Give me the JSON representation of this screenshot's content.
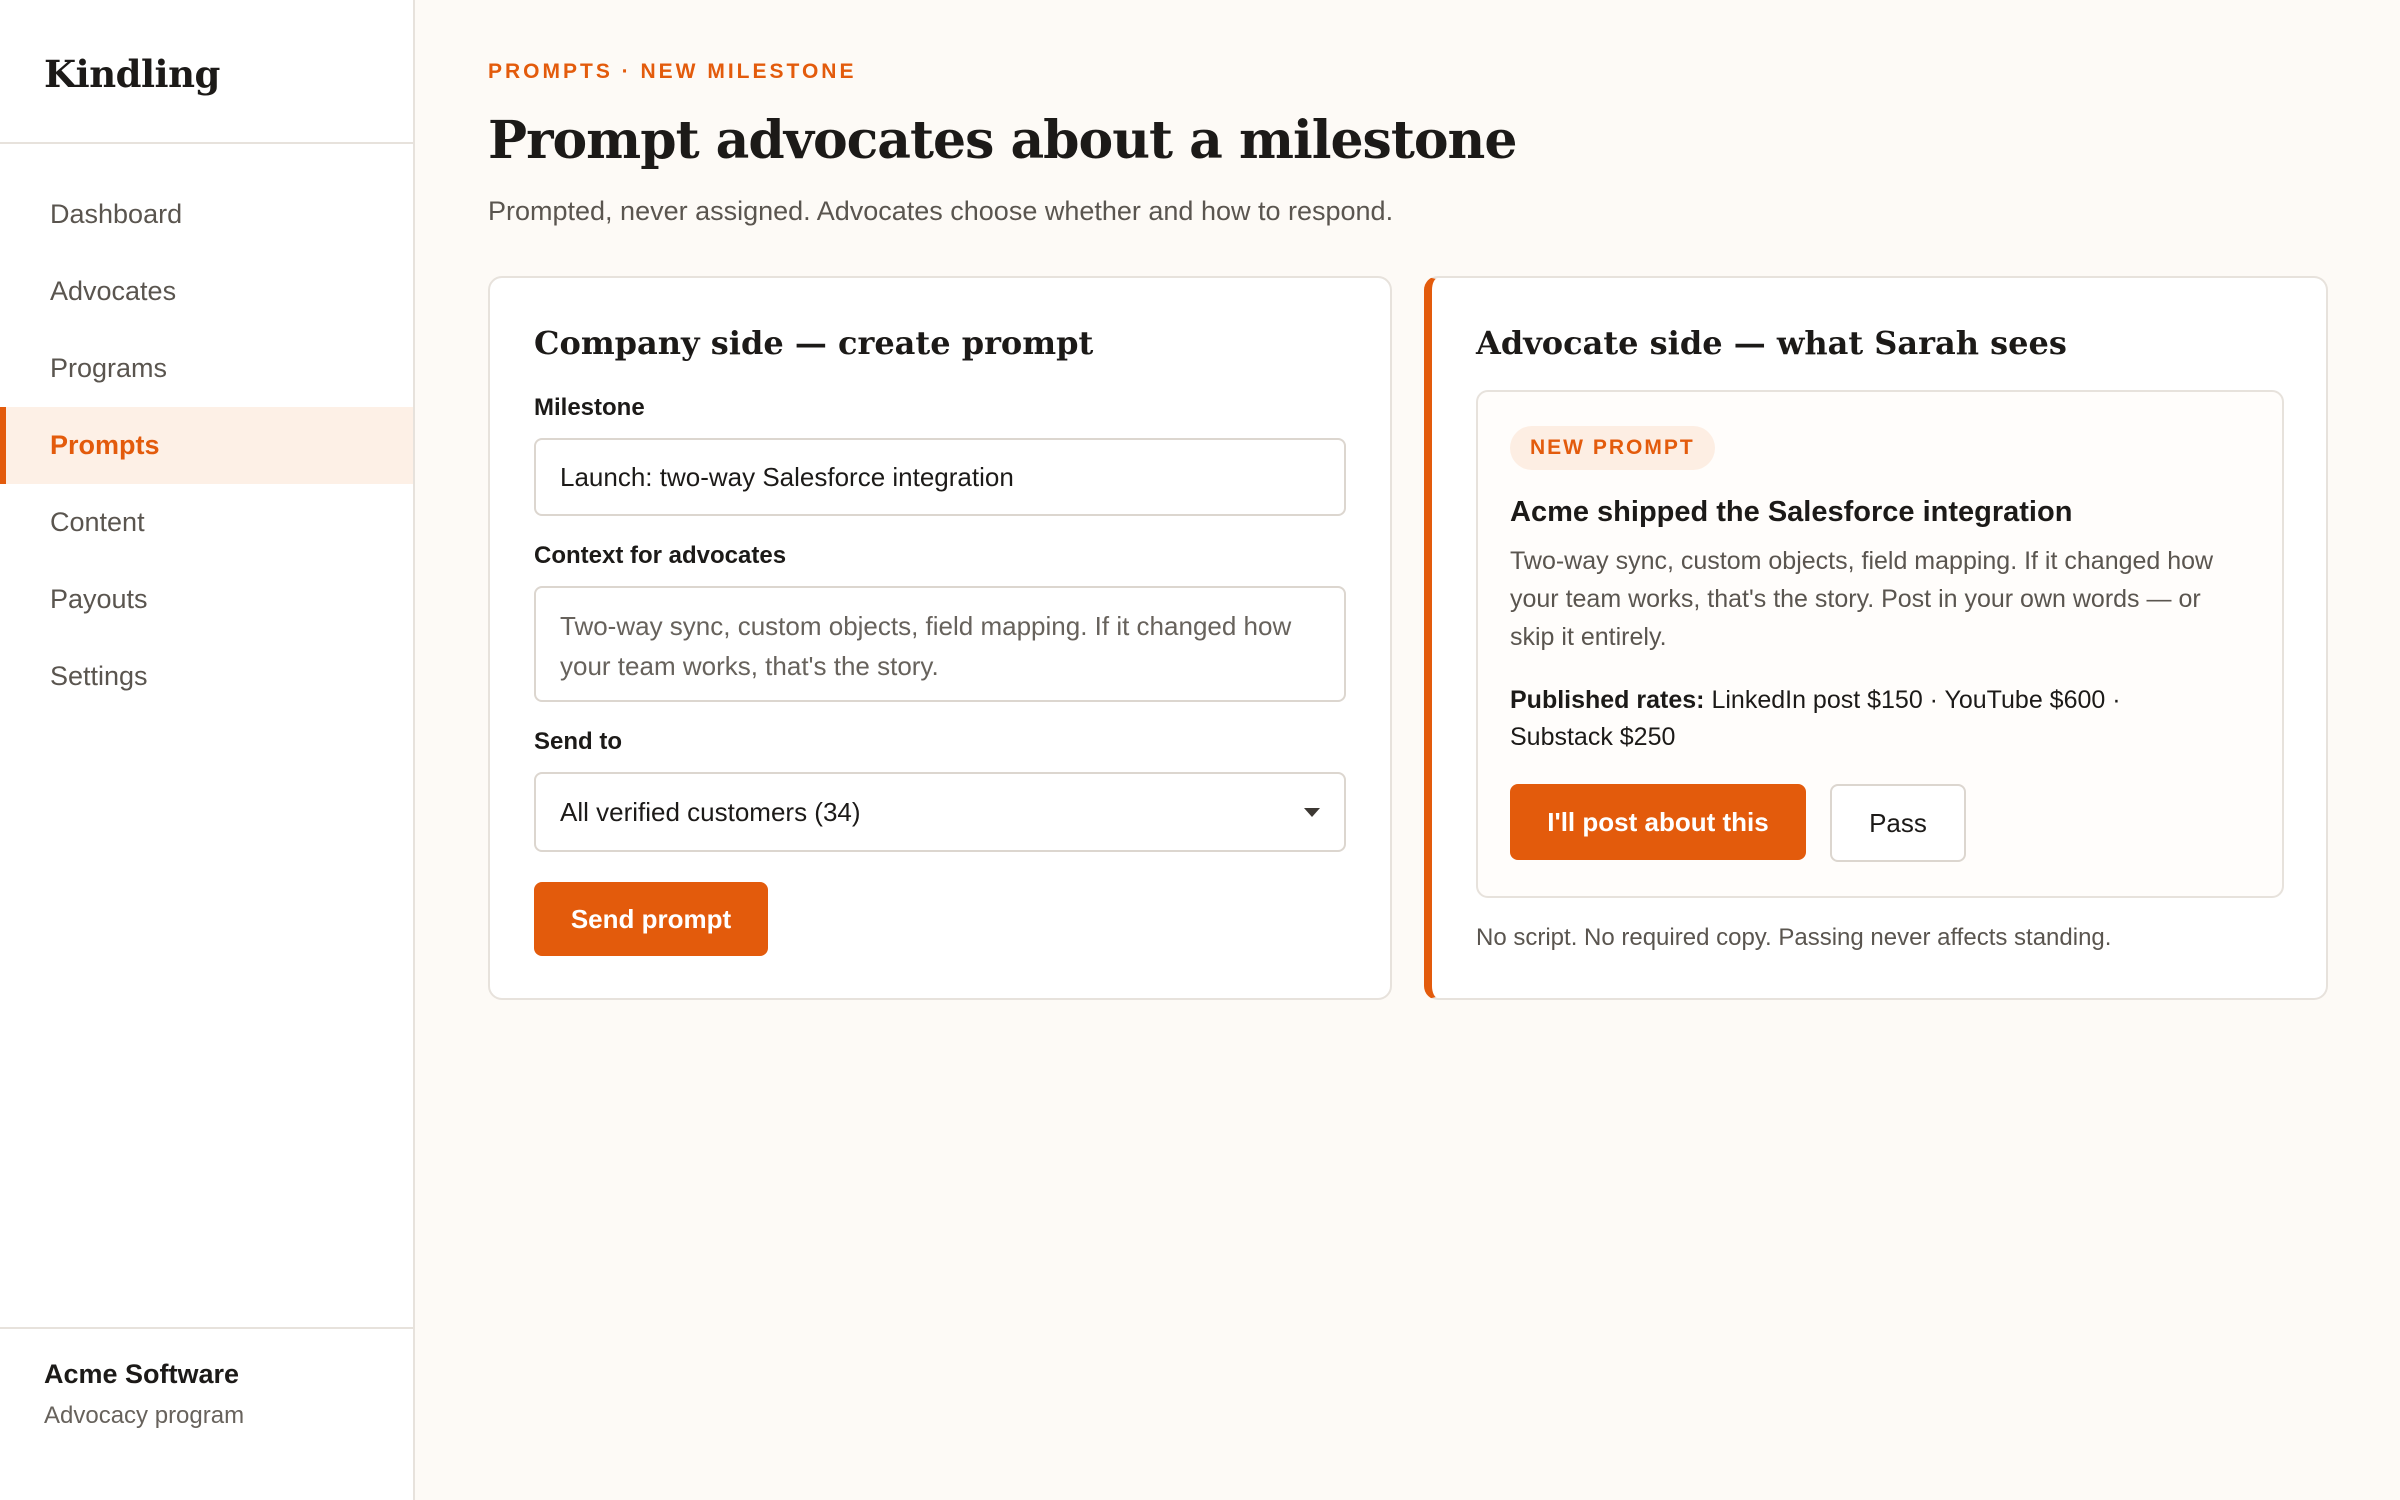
{
  "app": {
    "name": "Kindling"
  },
  "sidebar": {
    "items": [
      {
        "label": "Dashboard",
        "active": false
      },
      {
        "label": "Advocates",
        "active": false
      },
      {
        "label": "Programs",
        "active": false
      },
      {
        "label": "Prompts",
        "active": true
      },
      {
        "label": "Content",
        "active": false
      },
      {
        "label": "Payouts",
        "active": false
      },
      {
        "label": "Settings",
        "active": false
      }
    ],
    "footer": {
      "org": "Acme Software",
      "sub": "Advocacy program"
    }
  },
  "header": {
    "breadcrumb": "PROMPTS · NEW MILESTONE",
    "title": "Prompt advocates about a milestone",
    "subtitle": "Prompted, never assigned. Advocates choose whether and how to respond."
  },
  "company": {
    "title": "Company side — create prompt",
    "milestone_label": "Milestone",
    "milestone_value": "Launch: two-way Salesforce integration",
    "context_label": "Context for advocates",
    "context_value": "Two-way sync, custom objects, field mapping. If it changed how your team works, that's the story.",
    "send_to_label": "Send to",
    "send_to_value": "All verified customers (34)",
    "send_button": "Send prompt"
  },
  "advocate": {
    "title": "Advocate side — what Sarah sees",
    "badge": "NEW PROMPT",
    "prompt_title": "Acme shipped the Salesforce integration",
    "prompt_body": "Two-way sync, custom objects, field mapping. If it changed how your team works, that's the story. Post in your own words — or skip it entirely.",
    "rates_label": "Published rates:",
    "rates_value": "LinkedIn post $150 · YouTube $600 · Substack $250",
    "post_button": "I'll post about this",
    "pass_button": "Pass",
    "footnote": "No script. No required copy. Passing never affects standing."
  },
  "colors": {
    "accent": "#e35b0c",
    "background": "#fdfaf6",
    "badge_bg": "#fdeee3"
  }
}
